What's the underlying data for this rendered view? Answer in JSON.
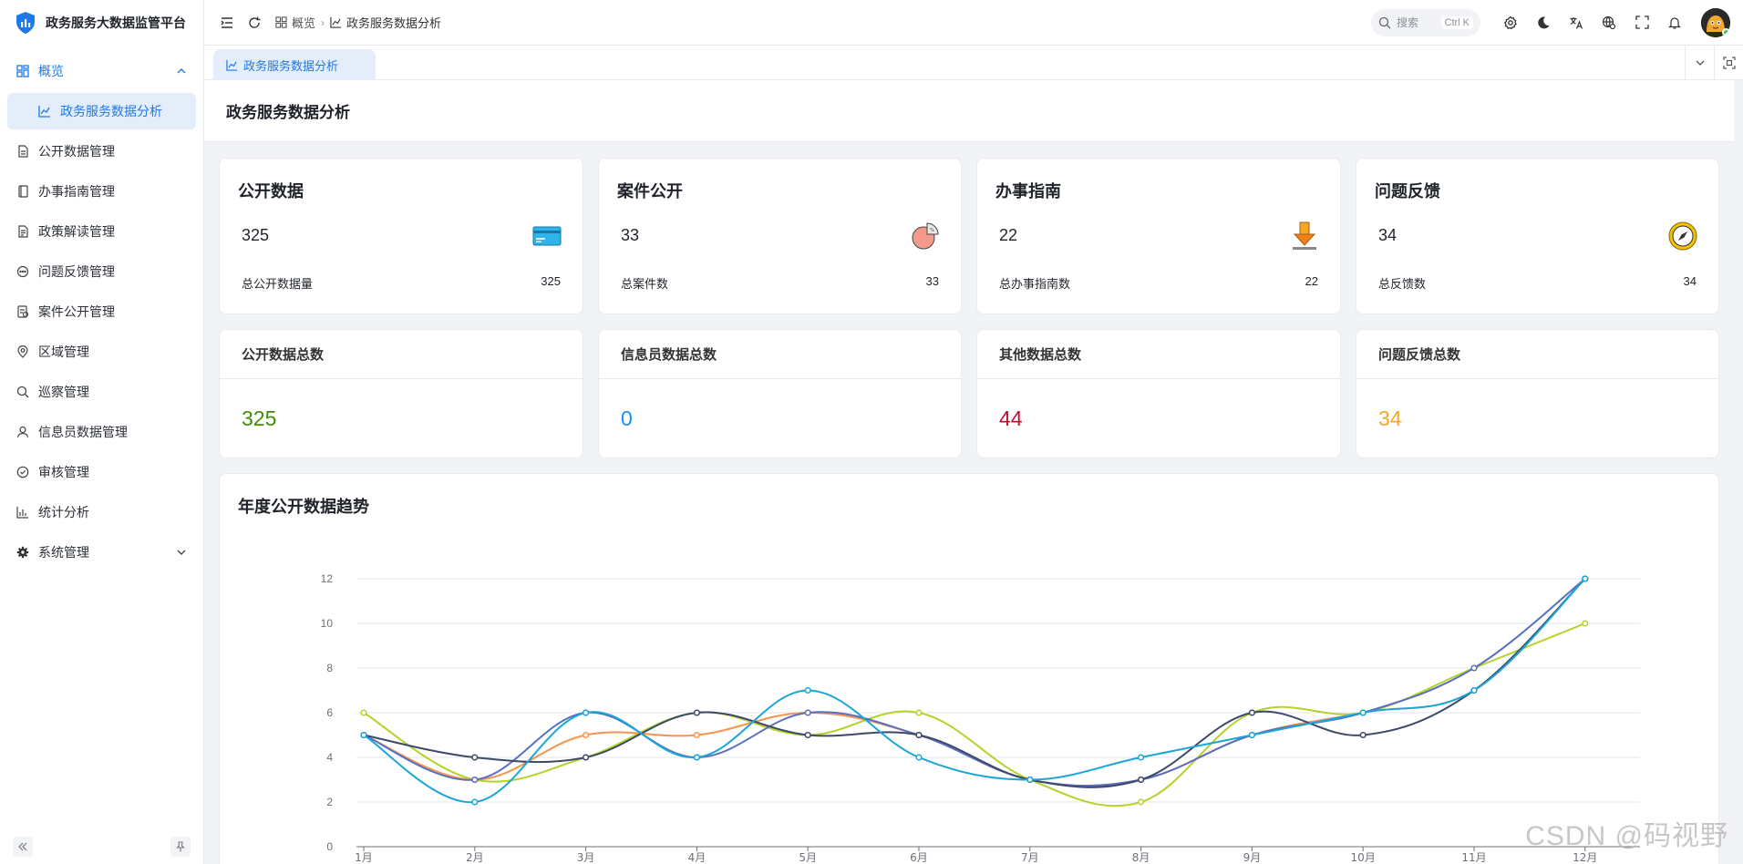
{
  "app": {
    "title": "政务服务大数据监管平台"
  },
  "sidebar": {
    "items": [
      {
        "label": "概览",
        "icon": "dashboard-icon",
        "expanded": true
      },
      {
        "label": "政务服务数据分析",
        "icon": "chart-icon",
        "active": true
      },
      {
        "label": "公开数据管理",
        "icon": "document-icon"
      },
      {
        "label": "办事指南管理",
        "icon": "book-icon"
      },
      {
        "label": "政策解读管理",
        "icon": "file-text-icon"
      },
      {
        "label": "问题反馈管理",
        "icon": "chat-icon"
      },
      {
        "label": "案件公开管理",
        "icon": "case-file-icon"
      },
      {
        "label": "区域管理",
        "icon": "location-icon"
      },
      {
        "label": "巡察管理",
        "icon": "search-icon"
      },
      {
        "label": "信息员数据管理",
        "icon": "user-icon"
      },
      {
        "label": "审核管理",
        "icon": "check-circle-icon"
      },
      {
        "label": "统计分析",
        "icon": "bar-chart-icon"
      },
      {
        "label": "系统管理",
        "icon": "gear-icon",
        "collapsed": true
      }
    ]
  },
  "header": {
    "breadcrumb": [
      "概览",
      "政务服务数据分析"
    ],
    "search_placeholder": "搜索",
    "search_shortcut": "Ctrl K"
  },
  "tabs": [
    {
      "label": "政务服务数据分析"
    }
  ],
  "page": {
    "title": "政务服务数据分析"
  },
  "stats": [
    {
      "title": "公开数据",
      "value": "325",
      "foot_label": "总公开数据量",
      "foot_value": "325",
      "icon": "credit-card-icon"
    },
    {
      "title": "案件公开",
      "value": "33",
      "foot_label": "总案件数",
      "foot_value": "33",
      "icon": "pie-icon"
    },
    {
      "title": "办事指南",
      "value": "22",
      "foot_label": "总办事指南数",
      "foot_value": "22",
      "icon": "download-icon"
    },
    {
      "title": "问题反馈",
      "value": "34",
      "foot_label": "总反馈数",
      "foot_value": "34",
      "icon": "compass-icon"
    }
  ],
  "totals": [
    {
      "title": "公开数据总数",
      "value": "325",
      "color": "#3f8f00"
    },
    {
      "title": "信息员数据总数",
      "value": "0",
      "color": "#1890ff"
    },
    {
      "title": "其他数据总数",
      "value": "44",
      "color": "#c0102d"
    },
    {
      "title": "问题反馈总数",
      "value": "34",
      "color": "#f5a623"
    }
  ],
  "chart_title": "年度公开数据趋势",
  "chart_data": {
    "type": "line",
    "categories": [
      "1月",
      "2月",
      "3月",
      "4月",
      "5月",
      "6月",
      "7月",
      "8月",
      "9月",
      "10月",
      "11月",
      "12月"
    ],
    "ylim": [
      0,
      12
    ],
    "yticks": [
      0,
      2,
      4,
      6,
      8,
      10,
      12
    ],
    "grid": true,
    "series": [
      {
        "color": "#b4d32a",
        "values": [
          6,
          3,
          4,
          6,
          5,
          6,
          3,
          2,
          6,
          6,
          8,
          10
        ]
      },
      {
        "color": "#f5954f",
        "values": [
          5,
          3,
          5,
          5,
          6,
          5,
          3,
          3,
          5,
          6,
          7,
          12
        ]
      },
      {
        "color": "#5a6fc0",
        "values": [
          5,
          3,
          6,
          4,
          6,
          5,
          3,
          3,
          5,
          6,
          8,
          12
        ]
      },
      {
        "color": "#3b4a6b",
        "values": [
          5,
          4,
          4,
          6,
          5,
          5,
          3,
          3,
          6,
          5,
          7,
          12
        ]
      },
      {
        "color": "#1ca6d8",
        "values": [
          5,
          2,
          6,
          4,
          7,
          4,
          3,
          4,
          5,
          6,
          7,
          12
        ]
      }
    ]
  },
  "watermark": "CSDN @码视野"
}
